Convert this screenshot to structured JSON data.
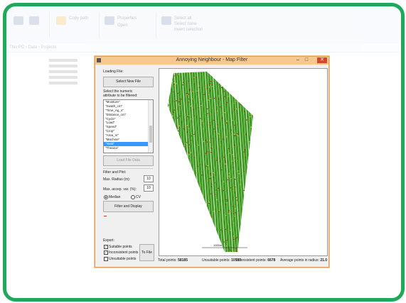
{
  "background_app": {
    "ribbon_labels": [
      "Copy path",
      "Properties",
      "Open",
      "Select all",
      "Select none",
      "Invert selection"
    ],
    "path_bar": "This PC › Data › Projects"
  },
  "window": {
    "title": "Annoying Neighbour - Map Filter",
    "controls": {
      "minimize": "–",
      "maximize": "□",
      "close": "✕"
    }
  },
  "loading": {
    "label": "Loading File:",
    "select_button": "Select New File",
    "attribute_label_line1": "Select the numeric",
    "attribute_label_line2": "attribute to be filtered:",
    "attributes": [
      "\"Moisture\"",
      "\"Swath_cm\"",
      "\"Time_Ag_s\"",
      "\"Distance_cm\"",
      "\"Cycle\"",
      "\"Load\"",
      "\"Speed\"",
      "\"Crop\"",
      "\"Area_m\"",
      "\"Machine\"",
      "\"Yield\"",
      "\"Theana\""
    ],
    "selected_index": 10,
    "load_button": "Load File Data"
  },
  "filter": {
    "label": "Filter and Plot:",
    "max_radius_label": "Max. Radius (m):",
    "max_radius_value": "10",
    "max_accep_label": "Max. accep. var. (%):",
    "max_accep_value": "10",
    "median_label": "Median",
    "cv_label": "CV",
    "median_selected": true,
    "filter_button": "Filter and Display"
  },
  "export": {
    "label": "Export:",
    "suitable_label": "Suitable points",
    "suitable_checked": true,
    "inconsistent_label": "Inconsistent points",
    "inconsistent_checked": true,
    "unsuitable_label": "Unsuitable points",
    "unsuitable_checked": false,
    "to_file_button": "To File"
  },
  "map": {
    "scale_label": "1000m",
    "colors": {
      "suitable": "#3c9a1e",
      "inconsistent": "#d8c02a",
      "unsuitable": "#b8221a"
    }
  },
  "status": {
    "total_label": "Total points:",
    "total_value": "58185",
    "unsuitable_label": "Unsuitable points:",
    "unsuitable_value": "10533",
    "inconsistent_label": "Inconsistent points:",
    "inconsistent_value": "6678",
    "avg_label": "Average points in radius:",
    "avg_value": "21.0"
  }
}
